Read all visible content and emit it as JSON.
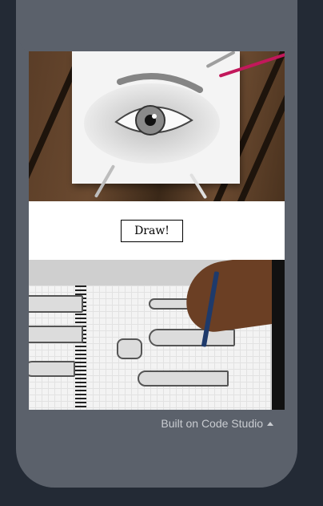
{
  "app": {
    "draw_button_label": "Draw!",
    "footer_text": "Built on Code Studio",
    "top_image_alt": "eye-drawing-photo",
    "bottom_image_alt": "sketchbook-photo"
  }
}
